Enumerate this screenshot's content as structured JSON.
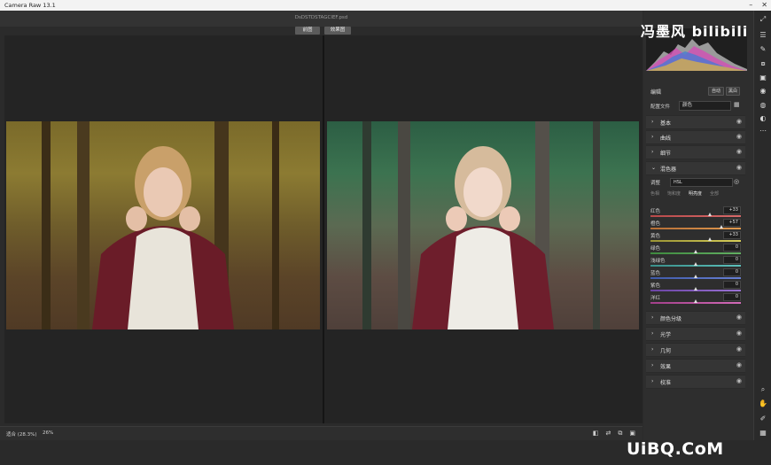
{
  "window": {
    "title": "Camera Raw 13.1",
    "file_name": "DsDSTDSTAGCIEF.psd"
  },
  "view_toggle": {
    "before": "前图",
    "after": "效果图"
  },
  "bottom": {
    "fit_label": "适合 (28.3%)",
    "zoom_label": "26%"
  },
  "watermark": {
    "text": "冯墨风 bilibili"
  },
  "panel": {
    "edit_title": "编辑",
    "auto_button": "自动",
    "bw_button": "黑白",
    "profile_label": "配置文件",
    "profile_value": "颜色",
    "sections_top": [
      {
        "name": "基本"
      },
      {
        "name": "曲线"
      },
      {
        "name": "细节"
      },
      {
        "name": "混色器"
      }
    ],
    "mixer": {
      "adjust_label": "调整",
      "adjust_value": "HSL",
      "tabs": [
        "色相",
        "饱和度",
        "明亮度",
        "全部"
      ],
      "active_tab": 2,
      "sliders": [
        {
          "name": "红色",
          "value": "+33",
          "pos": 0.66,
          "colors": [
            "#b84a4a",
            "#d86a6a"
          ]
        },
        {
          "name": "橙色",
          "value": "+57",
          "pos": 0.78,
          "colors": [
            "#b56e36",
            "#e0994f"
          ]
        },
        {
          "name": "黄色",
          "value": "+33",
          "pos": 0.66,
          "colors": [
            "#9a9434",
            "#d8cf59"
          ]
        },
        {
          "name": "绿色",
          "value": "0",
          "pos": 0.5,
          "colors": [
            "#3e8a3e",
            "#63b063"
          ]
        },
        {
          "name": "浅绿色",
          "value": "0",
          "pos": 0.5,
          "colors": [
            "#3a8f8a",
            "#5cc0bb"
          ]
        },
        {
          "name": "蓝色",
          "value": "0",
          "pos": 0.5,
          "colors": [
            "#3f5aa8",
            "#6880d3"
          ]
        },
        {
          "name": "紫色",
          "value": "0",
          "pos": 0.5,
          "colors": [
            "#6a44a4",
            "#9a72d4"
          ]
        },
        {
          "name": "洋红",
          "value": "0",
          "pos": 0.5,
          "colors": [
            "#a33f8a",
            "#d36bb8"
          ]
        }
      ]
    },
    "sections_bottom": [
      {
        "name": "颜色分级"
      },
      {
        "name": "光学"
      },
      {
        "name": "几何"
      },
      {
        "name": "效果"
      },
      {
        "name": "校准"
      }
    ]
  },
  "logo": {
    "text": "UiBQ.CoM"
  },
  "colors": {
    "accent": "#ffffff",
    "panel": "#2e2e2e",
    "canvas": "#242424"
  }
}
